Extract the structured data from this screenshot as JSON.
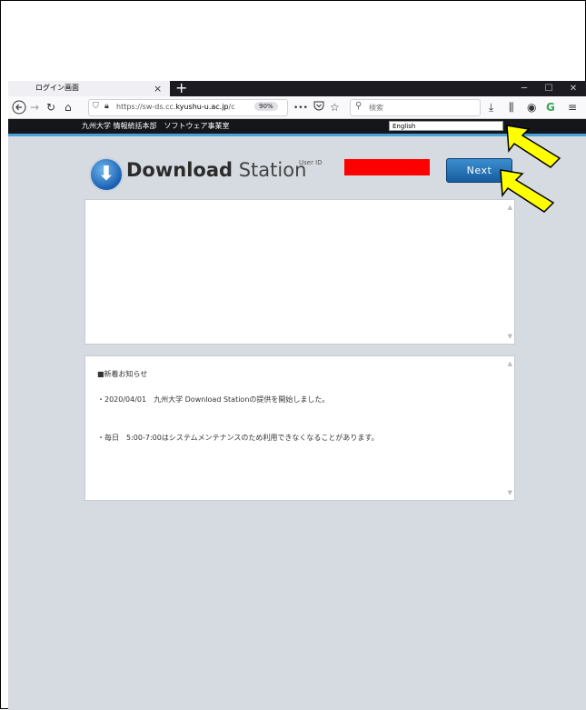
{
  "browser": {
    "tab_title": "ログイン画面",
    "tab_close": "×",
    "new_tab": "+",
    "minimize": "─",
    "maximize": "☐",
    "close": "✕",
    "url_prefix": "https://sw-ds.cc.",
    "url_domain": "kyushu-u.ac.jp",
    "url_suffix": "/c",
    "zoom": "90%",
    "more": "•••",
    "search_placeholder": "検索"
  },
  "site": {
    "header_text": "九州大学 情報統括本部　ソフトウェア事業室",
    "language": "English",
    "logo_bold": "Download",
    "logo_thin": " Station",
    "userid_label": "User ID",
    "next_label": "Next"
  },
  "news": {
    "heading": "■新着お知らせ",
    "items": [
      "・2020/04/01　九州大学 Download Stationの提供を開始しました。",
      "・毎日　5:00-7:00はシステムメンテナンスのため利用できなくなることがあります。"
    ]
  },
  "colors": {
    "accent_blue": "#1a5fb0",
    "redaction": "#ff0000",
    "pointer_yellow": "#ffff00"
  }
}
